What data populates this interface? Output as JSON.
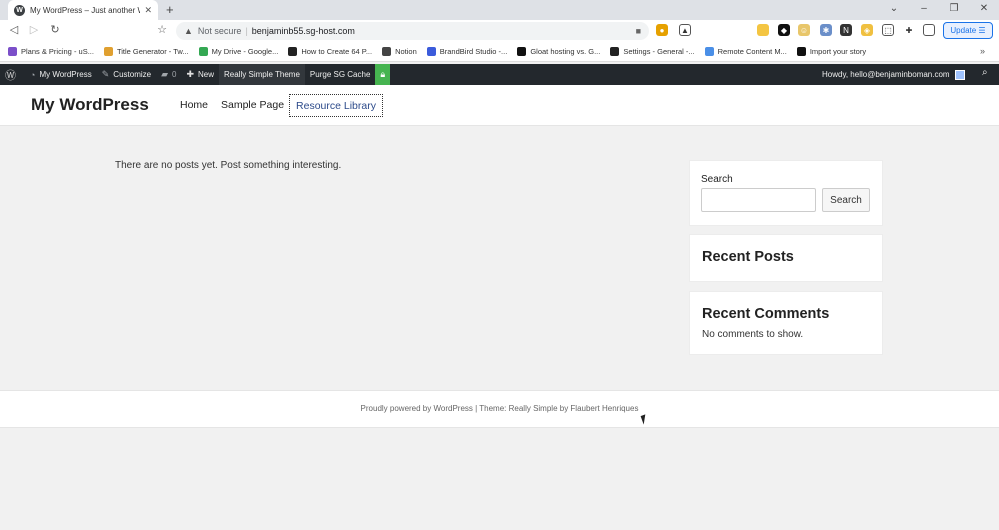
{
  "browser": {
    "tab_title": "My WordPress – Just another Wo",
    "tab_close": "✕",
    "new_tab": "+",
    "window_controls": [
      "⌄",
      "–",
      "❐",
      "✕"
    ],
    "nav": {
      "back": "◁",
      "forward": "▷",
      "reload": "↻",
      "bookmark": "☆"
    },
    "security_label": "Not secure",
    "url": "benjaminb55.sg-host.com",
    "update_label": "Update",
    "bookmarks": [
      {
        "label": "Plans & Pricing - uS...",
        "color": "#7b4fc9"
      },
      {
        "label": "Title Generator - Tw...",
        "color": "#e0a030"
      },
      {
        "label": "My Drive - Google...",
        "color": "#34a853"
      },
      {
        "label": "How to Create 64 P...",
        "color": "#222222"
      },
      {
        "label": "Notion",
        "color": "#444444"
      },
      {
        "label": "BrandBird Studio -...",
        "color": "#3b5bdb"
      },
      {
        "label": "Gloat hosting vs. G...",
        "color": "#111111"
      },
      {
        "label": "Settings - General -...",
        "color": "#222222"
      },
      {
        "label": "Remote Content M...",
        "color": "#4a8fe7"
      },
      {
        "label": "Import your story",
        "color": "#111111"
      }
    ],
    "bookmarks_more": "»"
  },
  "adminbar": {
    "site_name": "My WordPress",
    "customize": "Customize",
    "comments_count": "0",
    "new": "New",
    "theme": "Really Simple Theme",
    "purge": "Purge SG Cache",
    "howdy": "Howdy, hello@benjaminboman.com"
  },
  "site": {
    "title": "My WordPress",
    "nav": [
      "Home",
      "Sample Page",
      "Resource Library"
    ]
  },
  "main": {
    "no_posts": "There are no posts yet. Post something interesting."
  },
  "sidebar": {
    "search_label": "Search",
    "search_placeholder": "",
    "search_button": "Search",
    "recent_posts_title": "Recent Posts",
    "recent_comments_title": "Recent Comments",
    "no_comments": "No comments to show."
  },
  "footer": {
    "text": "Proudly powered by WordPress | Theme: Really Simple by Flaubert Henriques"
  }
}
